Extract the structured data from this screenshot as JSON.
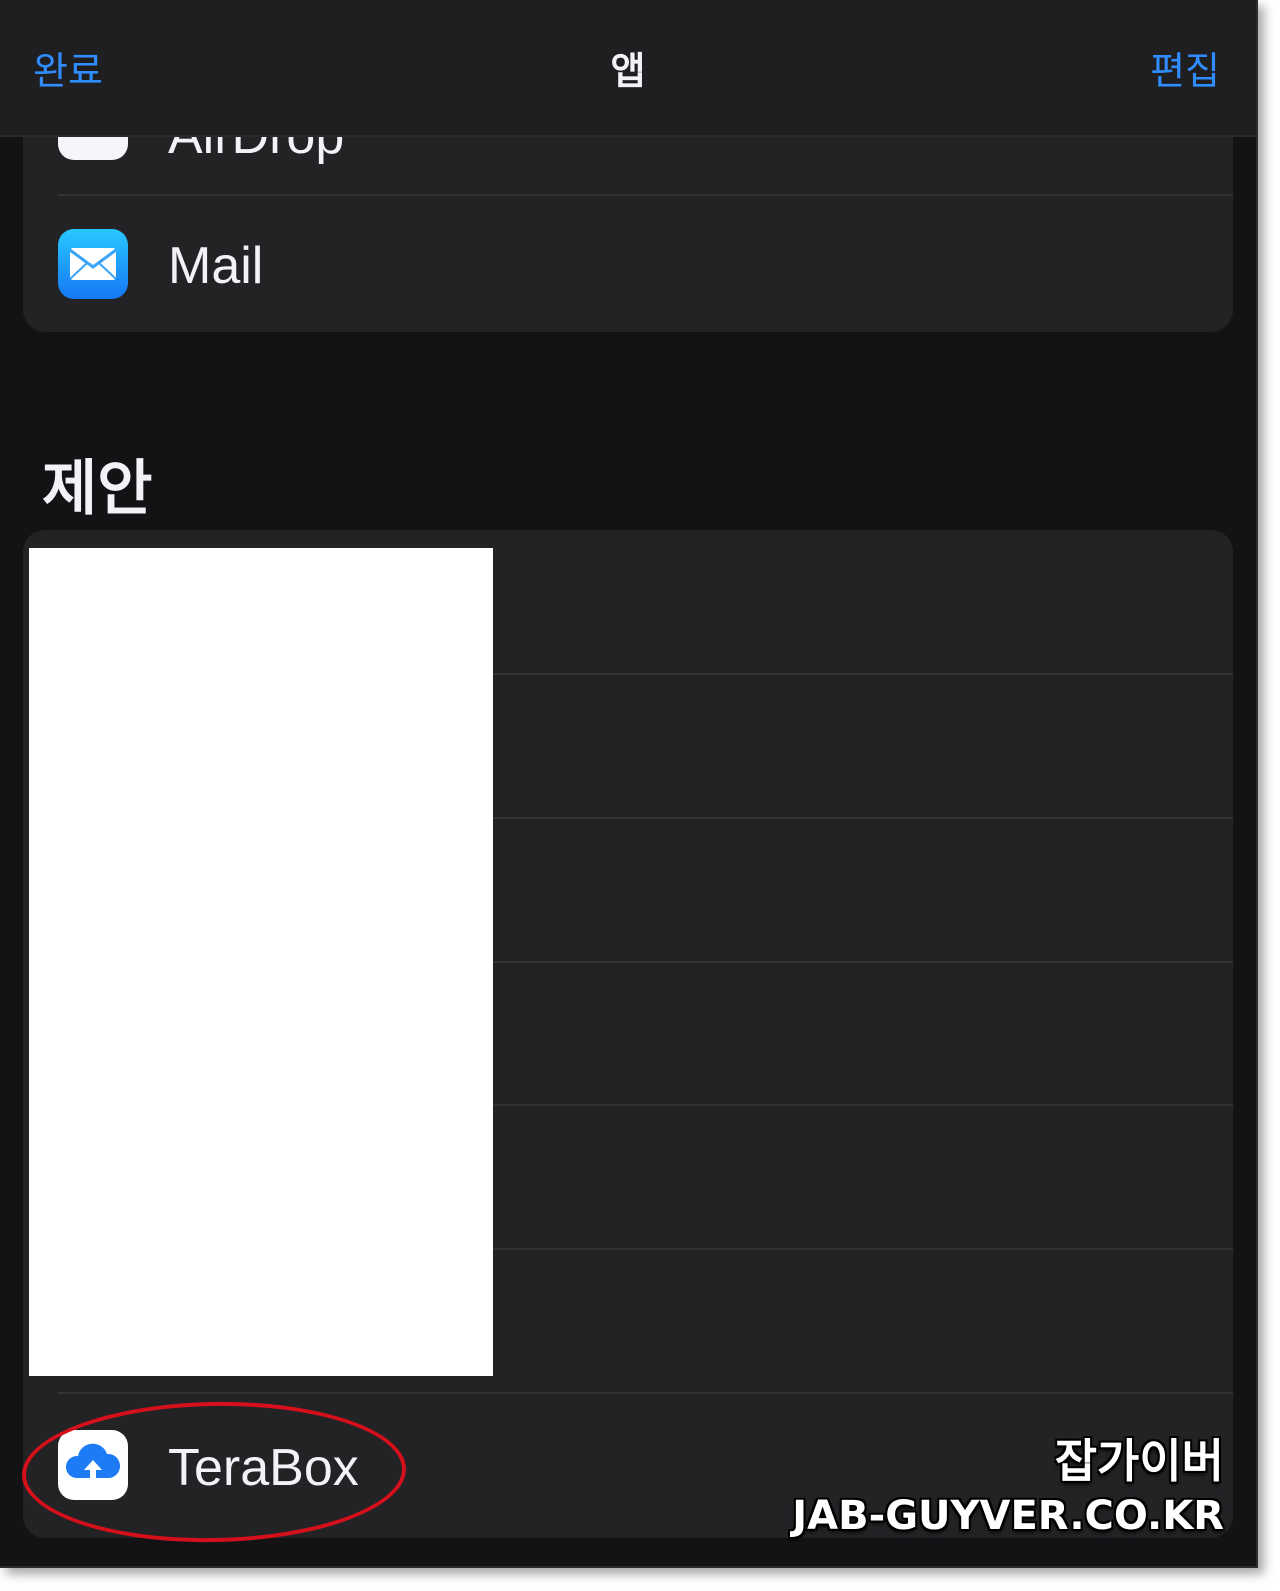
{
  "navbar": {
    "done_label": "완료",
    "title": "앱",
    "edit_label": "편집"
  },
  "top_group": {
    "items": [
      {
        "label": "AirDrop",
        "icon": "airdrop-icon"
      },
      {
        "label": "Mail",
        "icon": "mail-icon"
      }
    ]
  },
  "suggestions": {
    "title": "제안",
    "items": [
      {
        "label": "TeraBox",
        "icon": "terabox-icon"
      }
    ]
  },
  "watermark": {
    "line1": "잡가이버",
    "line2": "JAB-GUYVER.CO.KR"
  },
  "colors": {
    "accent": "#2f8dff",
    "background": "#131315",
    "group": "#232326",
    "highlight": "#d6101b"
  }
}
